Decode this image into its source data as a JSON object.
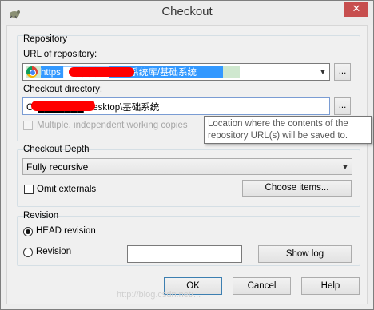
{
  "window": {
    "title": "Checkout",
    "close_glyph": "✕"
  },
  "repository": {
    "group_label": "Repository",
    "url_label": "URL of repository:",
    "url_value": "https ███████ 基础系统库/基础系统",
    "browse_label": "...",
    "checkout_dir_label": "Checkout directory:",
    "checkout_dir_value": "C:\\███████ Desktop\\基础系统",
    "multiple_label": "Multiple, independent working copies"
  },
  "tooltip": {
    "text": "Location where the contents of the repository URL(s) will be saved to."
  },
  "depth": {
    "group_label": "Checkout Depth",
    "selected": "Fully recursive",
    "omit_label": "Omit externals",
    "choose_items_label": "Choose items..."
  },
  "revision": {
    "group_label": "Revision",
    "head_label": "HEAD revision",
    "revision_label": "Revision",
    "revision_value": "",
    "show_log_label": "Show log"
  },
  "buttons": {
    "ok": "OK",
    "cancel": "Cancel",
    "help": "Help"
  },
  "watermark": "http://blog.csdn.net/..."
}
